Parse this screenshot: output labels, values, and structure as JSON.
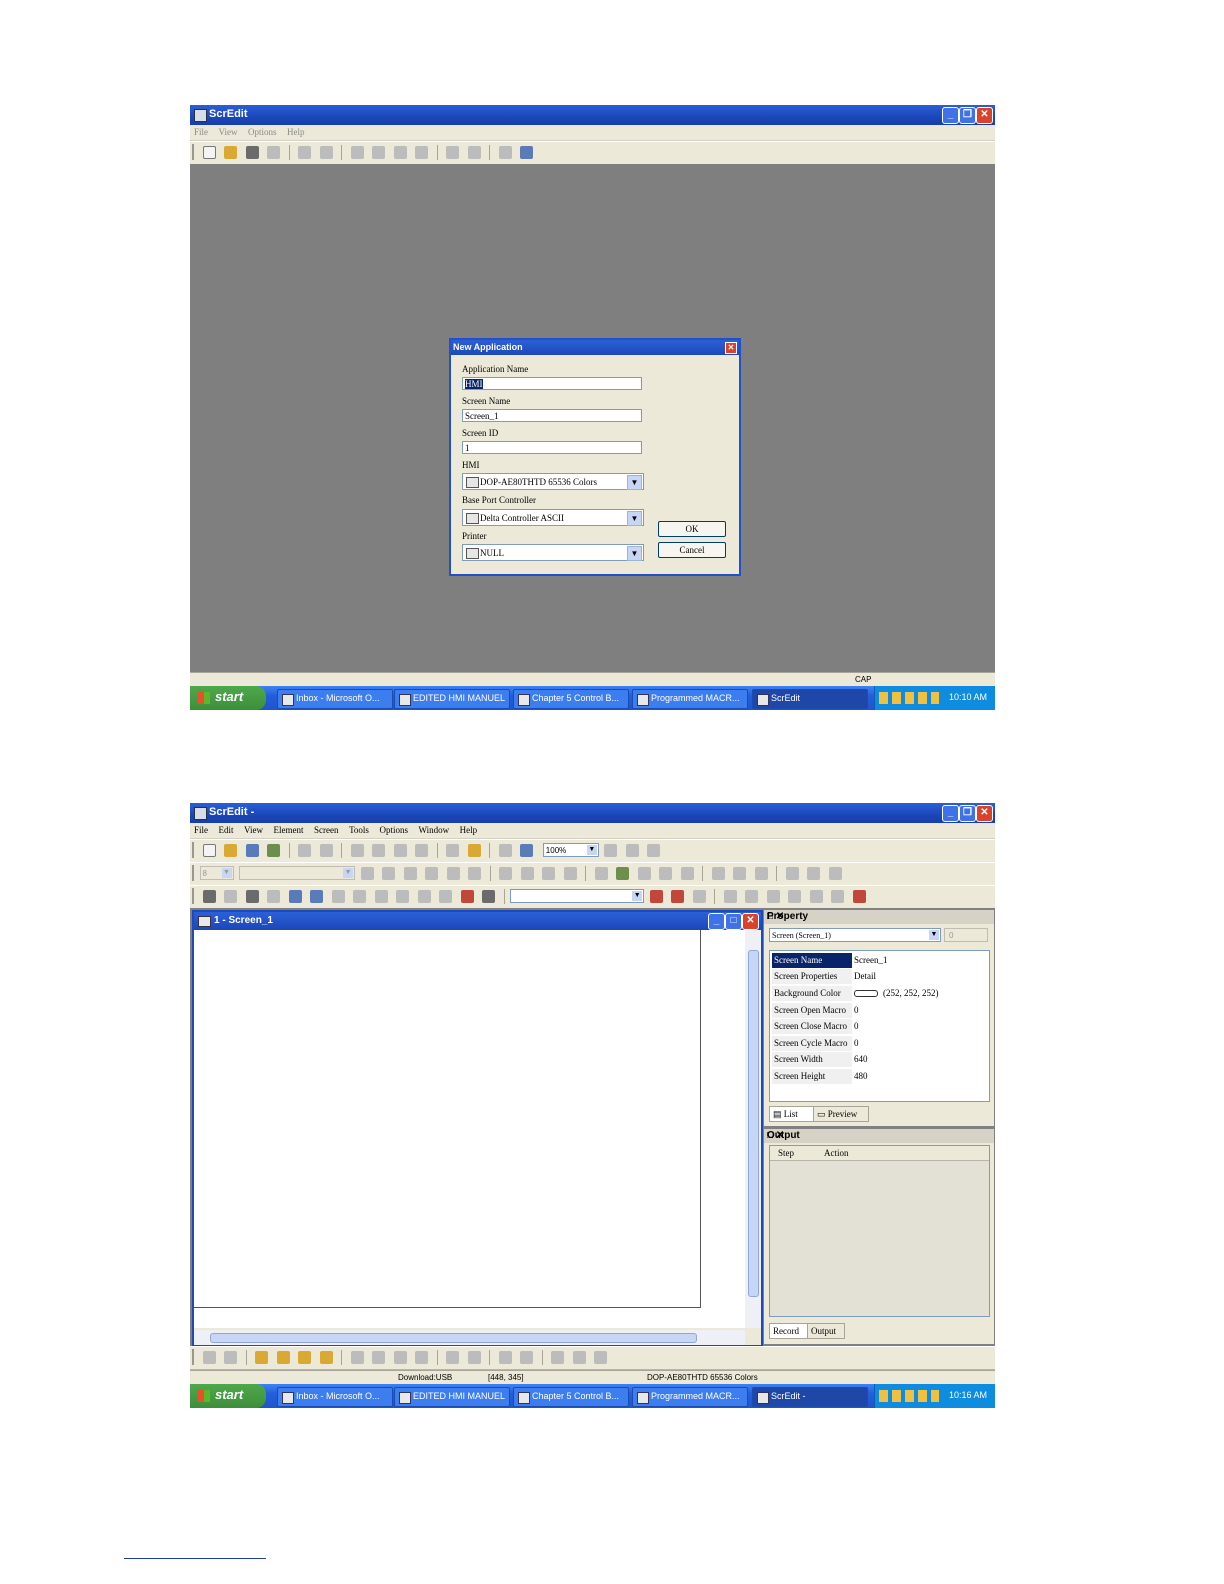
{
  "screen1": {
    "window_title": "ScrEdit",
    "window_buttons": {
      "minimize": "_",
      "restore": "❐",
      "close": "✕"
    },
    "menu": [
      "File",
      "View",
      "Options",
      "Help"
    ],
    "dialog": {
      "title": "New Application",
      "close": "✕",
      "app_name_label": "Application Name",
      "app_name_value": "HMI",
      "screen_name_label": "Screen Name",
      "screen_name_value": "Screen_1",
      "screen_id_label": "Screen ID",
      "screen_id_value": "1",
      "hmi_label": "HMI",
      "hmi_value": "DOP-AE80THTD 65536 Colors",
      "controller_label": "Base Port Controller",
      "controller_value": "Delta Controller ASCII",
      "printer_label": "Printer",
      "printer_value": "NULL",
      "ok": "OK",
      "cancel": "Cancel",
      "arrow": "▼"
    },
    "status": {
      "caps": "CAP"
    },
    "taskbar": {
      "start": "start",
      "tasks": [
        "Inbox - Microsoft O...",
        "EDITED HMI MANUEL",
        "Chapter 5 Control B...",
        "Programmed MACR...",
        "ScrEdit"
      ],
      "clock": "10:10 AM"
    }
  },
  "screen2": {
    "window_title": "ScrEdit -",
    "window_buttons": {
      "minimize": "_",
      "restore": "❐",
      "close": "✕"
    },
    "menu": [
      "File",
      "Edit",
      "View",
      "Element",
      "Screen",
      "Tools",
      "Options",
      "Window",
      "Help"
    ],
    "zoom": "100%",
    "font_size": "8",
    "arrow": "▼",
    "mdi": {
      "title": "1 - Screen_1",
      "min": "_",
      "max": "□",
      "close": "✕"
    },
    "property": {
      "title": "Property",
      "controls": "□ ✕",
      "object": "Screen (Screen_1)",
      "spin": "0",
      "rows": [
        {
          "key": "Screen Name",
          "value": "Screen_1"
        },
        {
          "key": "Screen Properties",
          "value": "Detail"
        },
        {
          "key": "Background Color",
          "value": "(252, 252, 252)"
        },
        {
          "key": "Screen Open Macro",
          "value": "0"
        },
        {
          "key": "Screen Close Macro",
          "value": "0"
        },
        {
          "key": "Screen Cycle Macro",
          "value": "0"
        },
        {
          "key": "Screen Width",
          "value": "640"
        },
        {
          "key": "Screen Height",
          "value": "480"
        }
      ],
      "tabs": [
        "List",
        "Preview"
      ]
    },
    "output": {
      "title": "Output",
      "controls": "□ ✕",
      "columns": [
        "Step",
        "Action"
      ],
      "tabs": [
        "Record",
        "Output"
      ]
    },
    "status": {
      "download": "Download:USB",
      "coords": "[448, 345]",
      "model": "DOP-AE80THTD 65536 Colors"
    },
    "taskbar": {
      "start": "start",
      "tasks": [
        "Inbox - Microsoft O...",
        "EDITED HMI MANUEL",
        "Chapter 5 Control B...",
        "Programmed MACR...",
        "ScrEdit -"
      ],
      "clock": "10:16 AM"
    }
  }
}
